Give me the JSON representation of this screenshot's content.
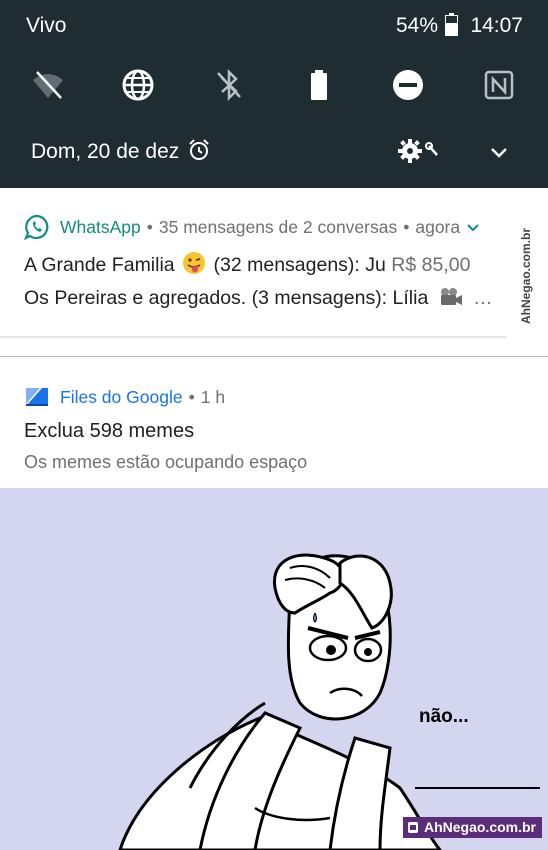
{
  "status_bar": {
    "carrier": "Vivo",
    "battery_percent": "54%",
    "time": "14:07"
  },
  "quick_settings": {
    "tiles": [
      "wifi-off-icon",
      "globe-icon",
      "bluetooth-off-icon",
      "battery-icon",
      "do-not-disturb-icon",
      "nfc-icon"
    ],
    "date": "Dom, 20 de dez"
  },
  "notifications": {
    "whatsapp": {
      "app_name": "WhatsApp",
      "summary": "35 mensagens de 2 conversas",
      "time": "agora",
      "line1_prefix": "A Grande Familia",
      "line1_suffix": "(32 mensagens): Ju",
      "line1_tail": "R$ 85,00",
      "line2": "Os Pereiras e agregados.  (3 mensagens): Lília",
      "line2_ellipsis": "…"
    },
    "files": {
      "app_name": "Files do Google",
      "time": "1 h",
      "title": "Exclua 598 memes",
      "body": "Os memes estão ocupando espaço"
    }
  },
  "meme": {
    "caption": "não...",
    "watermark": "AhNegao.com.br",
    "side_watermark": "AhNegao.com.br"
  },
  "colors": {
    "panel_bg": "#1f2d33",
    "whatsapp_green": "#128c7e",
    "files_blue": "#1a73e8",
    "meme_bg": "#d3d6ee",
    "watermark_bg": "#5b2c7a"
  }
}
